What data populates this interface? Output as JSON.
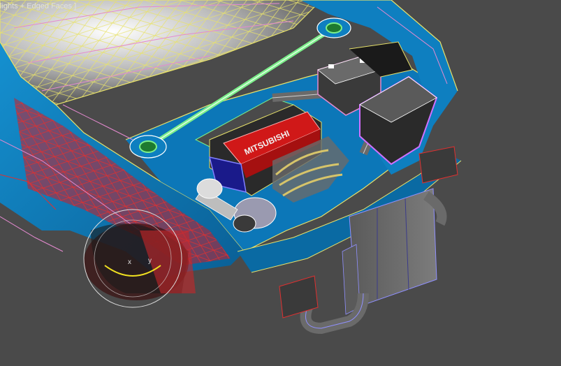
{
  "viewport": {
    "label": "lights + Edged Faces ]",
    "shading_mode": "Edged Faces",
    "background_color": "#4a4a4a"
  },
  "scene": {
    "engine_cover_text": "MITSUBISHI",
    "gizmo_axes": [
      "x",
      "y"
    ]
  },
  "colors": {
    "body_panel": "#0e7fc0",
    "body_dark": "#0a5f95",
    "wire_yellow": "#e8e26a",
    "wire_pink": "#e58ad0",
    "wire_red": "#e03030",
    "wire_green": "#7cf08a",
    "wire_white": "#f0f0f0",
    "engine_red": "#d01818",
    "engine_dark": "#2a2a2a",
    "metal_grey": "#7a7a7a",
    "intercooler": "#6a6a6a"
  }
}
